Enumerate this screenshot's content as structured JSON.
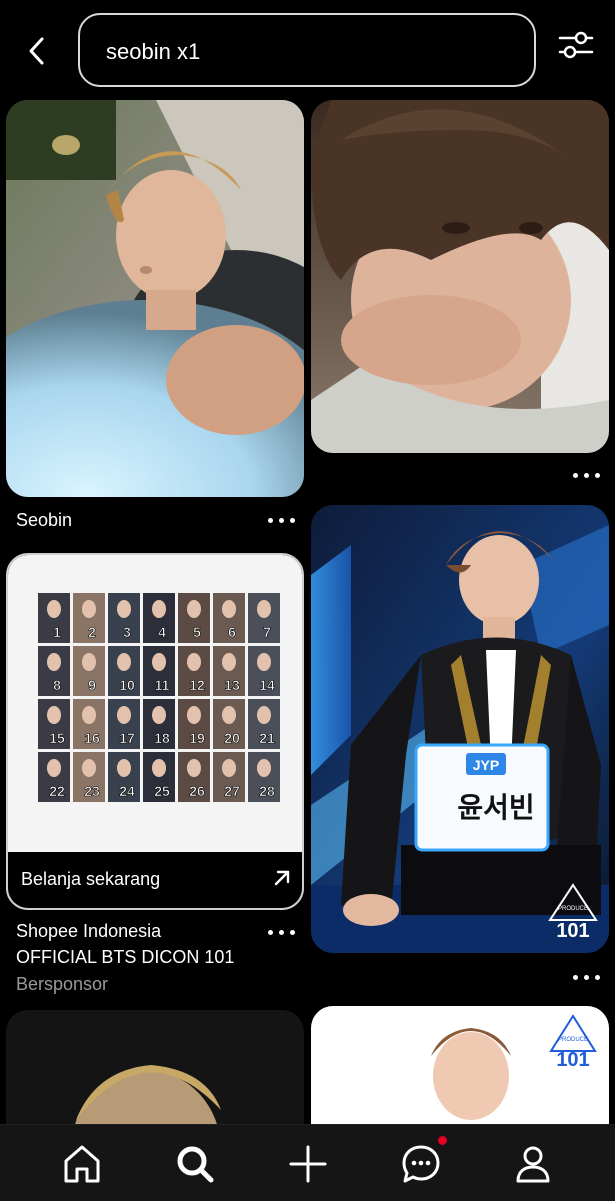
{
  "search": {
    "query": "seobin x1"
  },
  "pins": {
    "pin1": {
      "title": "Seobin"
    },
    "ad": {
      "cta": "Belanja sekarang",
      "advertiser": "Shopee Indonesia",
      "title": "OFFICIAL BTS DICON 101",
      "sponsored": "Bersponsor",
      "card_numbers": [
        "1",
        "2",
        "3",
        "4",
        "5",
        "6",
        "7",
        "8",
        "9",
        "10",
        "11",
        "12",
        "13",
        "14",
        "15",
        "16",
        "17",
        "18",
        "19",
        "20",
        "21",
        "22",
        "23",
        "24",
        "25",
        "26",
        "27",
        "28"
      ]
    },
    "pin4": {
      "name_tag_top": "JYP",
      "name_tag_name": "윤서빈",
      "logo_small": "PRODUCE",
      "logo_big": "101"
    },
    "pin6": {
      "logo_small": "PRODUCE",
      "logo_big": "101"
    }
  },
  "nav": {
    "items": [
      "home-icon",
      "search-icon",
      "create-icon",
      "messages-icon",
      "profile-icon"
    ],
    "notification_color": "#e60023"
  }
}
